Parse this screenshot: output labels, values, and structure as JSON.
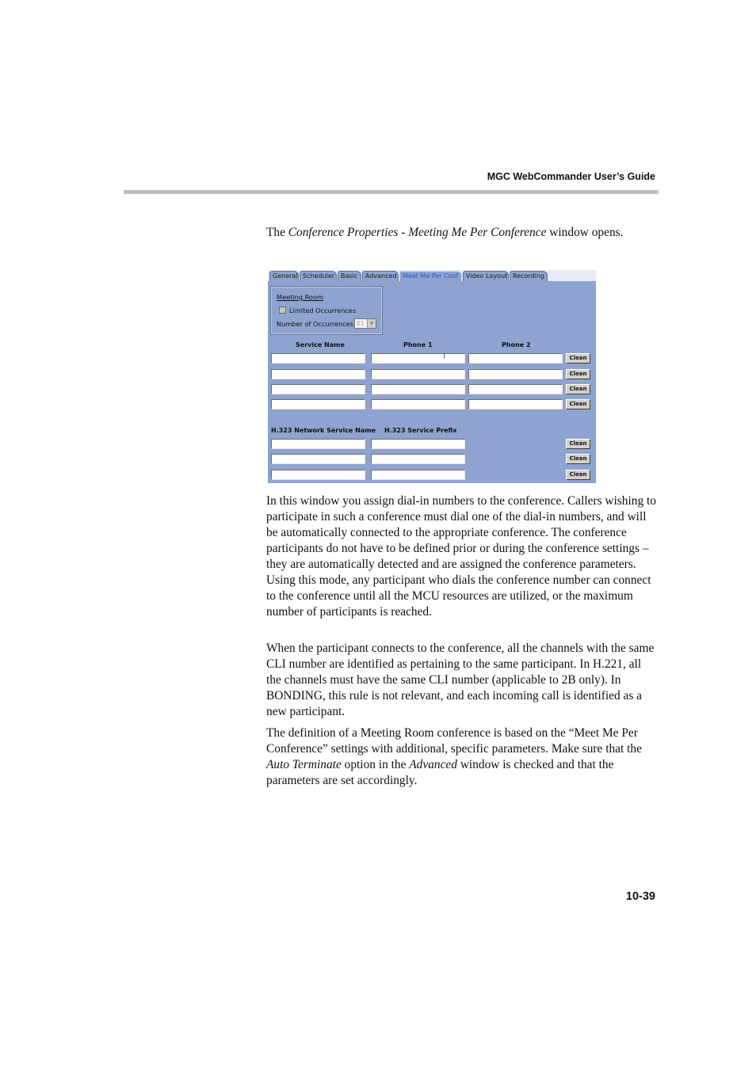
{
  "header": {
    "running_title": "MGC WebCommander User’s Guide"
  },
  "intro": {
    "pre": "The ",
    "italic": "Conference Properties - Meeting Me Per Conference",
    "post": " window opens."
  },
  "window": {
    "tabs": [
      {
        "label": "General",
        "active": false
      },
      {
        "label": "Scheduler",
        "active": false
      },
      {
        "label": "Basic",
        "active": false
      },
      {
        "label": "Advanced",
        "active": false
      },
      {
        "label": "Meet Me Per Conf",
        "active": true
      },
      {
        "label": "Video Layout",
        "active": false
      },
      {
        "label": "Recording",
        "active": false
      }
    ],
    "meeting_room": {
      "title": "Meeting Room",
      "limited_occurrences_label": "Limited Occurrences",
      "limited_occurrences_checked": false,
      "num_occurrences_label": "Number of Occurrences:",
      "num_occurrences_value": "01"
    },
    "dialin": {
      "headers": [
        "Service Name",
        "Phone 1",
        "Phone 2"
      ],
      "rows": [
        {
          "service_name": "",
          "phone1": "",
          "phone2": ""
        },
        {
          "service_name": "",
          "phone1": "",
          "phone2": ""
        },
        {
          "service_name": "",
          "phone1": "",
          "phone2": ""
        },
        {
          "service_name": "",
          "phone1": "",
          "phone2": ""
        }
      ],
      "clean_label": "Clean"
    },
    "h323": {
      "headers": [
        "H.323 Network Service Name",
        "H.323 Service Prefix"
      ],
      "rows": [
        {
          "service_name": "",
          "prefix": ""
        },
        {
          "service_name": "",
          "prefix": ""
        },
        {
          "service_name": "",
          "prefix": ""
        }
      ],
      "clean_label": "Clean"
    },
    "colors": {
      "panel": "#8ea3cf",
      "tabbar": "#e6ebf5",
      "active_tab_text": "#1f5fd0"
    }
  },
  "body": {
    "p1": "In this window you assign dial-in numbers to the conference. Callers wishing to participate in such a conference must dial one of the dial-in numbers, and will be automatically connected to the appropriate conference. The conference participants do not have to be defined prior or during the conference settings – they are automatically detected and are assigned the conference parameters. Using this mode, any participant who dials the conference number can connect to the conference until all the MCU resources are utilized, or the maximum number of participants is reached.",
    "p2": "When the participant connects to the conference, all the channels with the same CLI number are identified as pertaining to the same participant. In H.221, all the channels must have the same CLI number (applicable to 2B only). In BONDING, this rule is not relevant, and each incoming call is identified as a new participant.",
    "p3": {
      "a": "The definition of a Meeting Room conference is based on the “Meet Me Per Conference” settings with additional, specific parameters. Make sure that the ",
      "b": "Auto Terminate",
      "c": " option in the ",
      "d": "Advanced",
      "e": " window is checked and that the parameters are set accordingly."
    }
  },
  "footer": {
    "page_number": "10-39"
  }
}
